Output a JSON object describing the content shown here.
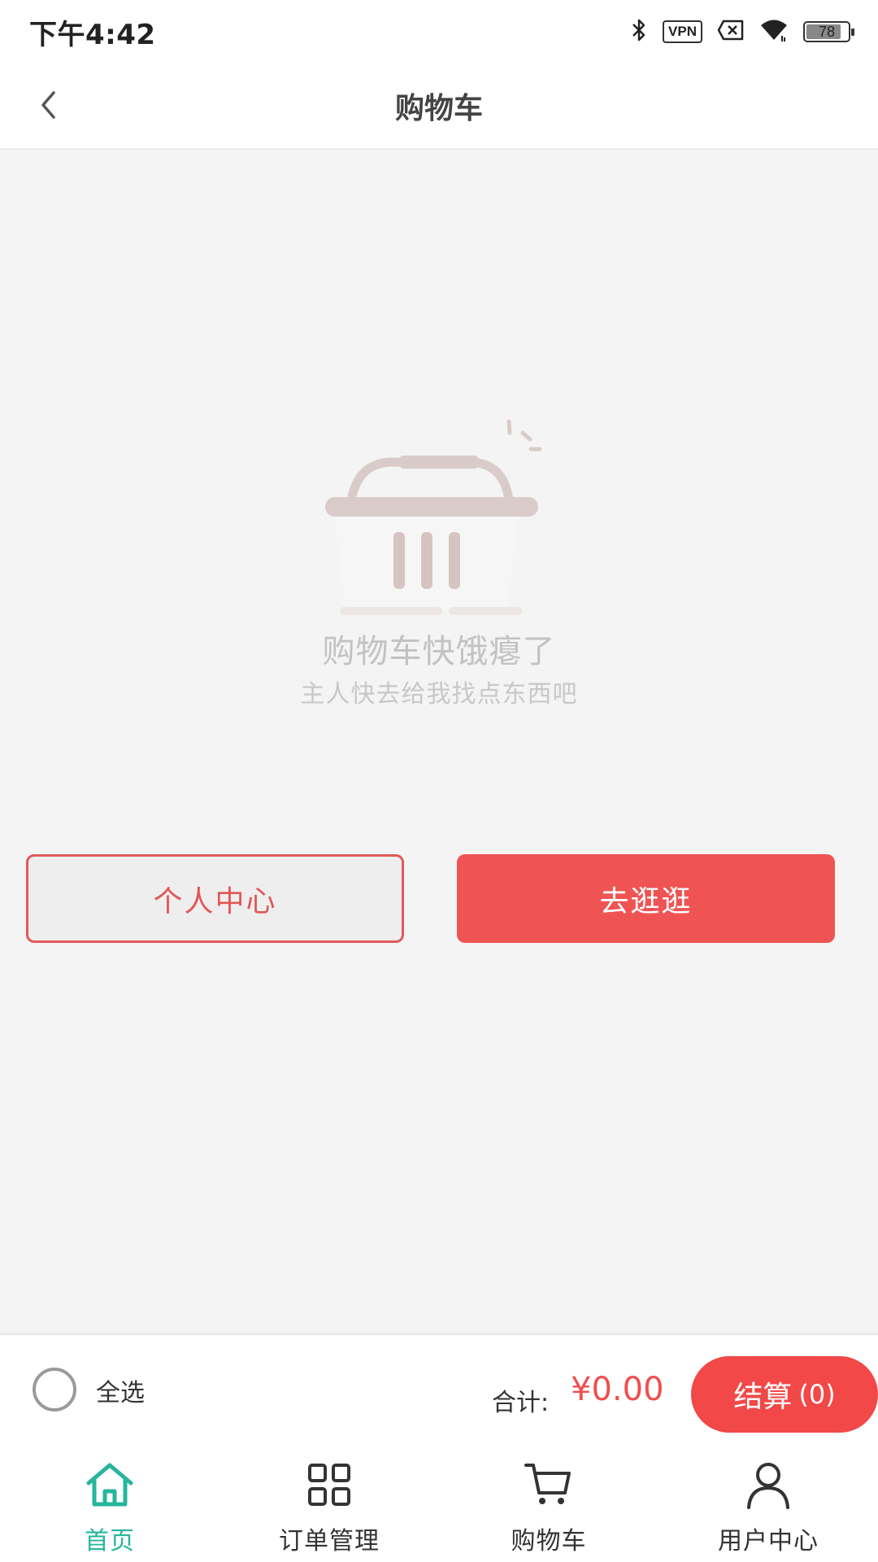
{
  "status_bar": {
    "time": "下午4:42",
    "vpn_label": "VPN",
    "battery_level": "78",
    "icons": [
      "bluetooth-icon",
      "vpn-icon",
      "sim-off-icon",
      "wifi-icon",
      "battery-icon"
    ]
  },
  "nav": {
    "title": "购物车",
    "back_icon": "chevron-left-icon"
  },
  "empty_state": {
    "icon": "shopping-basket-icon",
    "title": "购物车快饿瘪了",
    "subtitle": "主人快去给我找点东西吧"
  },
  "actions": {
    "personal_center_label": "个人中心",
    "go_shopping_label": "去逛逛"
  },
  "checkout": {
    "select_all_label": "全选",
    "total_label": "合计:",
    "total_amount": "¥0.00",
    "checkout_label": "结算",
    "checkout_count": "(0)"
  },
  "tabs": [
    {
      "label": "首页",
      "icon": "home-icon",
      "active": true
    },
    {
      "label": "订单管理",
      "icon": "grid-icon",
      "active": false
    },
    {
      "label": "购物车",
      "icon": "cart-icon",
      "active": false
    },
    {
      "label": "用户中心",
      "icon": "user-icon",
      "active": false
    }
  ],
  "colors": {
    "accent_red": "#f05353",
    "active_tab": "#27b59c",
    "illustration": "#d8c8c6"
  }
}
